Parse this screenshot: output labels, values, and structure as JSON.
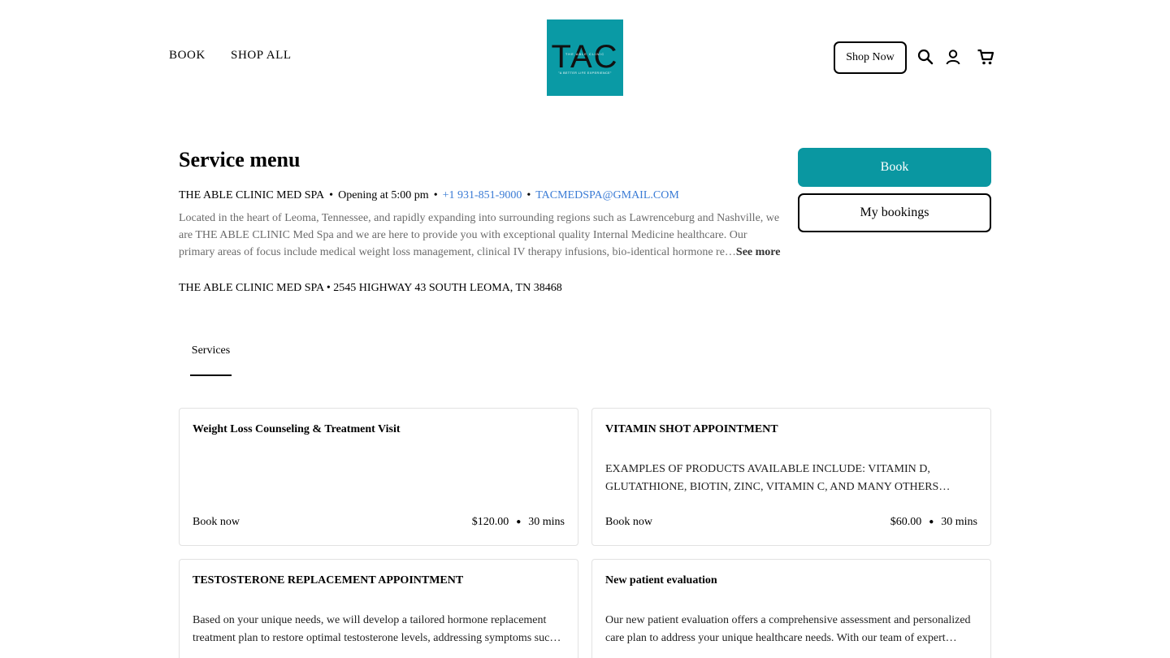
{
  "header": {
    "nav": [
      "BOOK",
      "SHOP ALL"
    ],
    "logo": {
      "text": "TAC",
      "arc_text": "THE ABLE CLINIC",
      "tagline": "\"A BETTER LIFE EXPERIENCE\""
    },
    "shop_now_label": "Shop Now",
    "icons": [
      "search-icon",
      "account-icon",
      "cart-icon"
    ]
  },
  "page": {
    "title": "Service menu",
    "business_name": "THE ABLE CLINIC MED SPA",
    "hours": "Opening at 5:00 pm",
    "phone": "+1 931-851-9000",
    "email": "TACMEDSPA@GMAIL.COM",
    "description": "Located in the heart of Leoma, Tennessee, and rapidly expanding into surrounding regions such as Lawrenceburg and Nashville, we are THE ABLE CLINIC Med Spa and we are here to provide you with exceptional quality Internal Medicine healthcare. Our primary areas of focus include medical weight loss management, clinical IV therapy infusions, bio-identical hormone re…",
    "see_more_label": "See more",
    "address": "THE ABLE CLINIC MED SPA • 2545 HIGHWAY 43 SOUTH LEOMA, TN 38468",
    "book_label": "Book",
    "my_bookings_label": "My bookings"
  },
  "tabs": [
    "Services"
  ],
  "services": [
    {
      "title": "Weight Loss Counseling & Treatment Visit",
      "description": "",
      "book_label": "Book now",
      "price": "$120.00",
      "duration": "30 mins"
    },
    {
      "title": "VITAMIN SHOT APPOINTMENT",
      "description": "EXAMPLES OF PRODUCTS AVAILABLE INCLUDE: VITAMIN D, GLUTATHIONE, BIOTIN, ZINC, VITAMIN C, AND MANY OTHERS…",
      "book_label": "Book now",
      "price": "$60.00",
      "duration": "30 mins"
    },
    {
      "title": "TESTOSTERONE REPLACEMENT APPOINTMENT",
      "description": "Based on your unique needs, we will develop a tailored hormone replacement treatment plan to restore optimal testosterone levels, addressing symptoms suc…",
      "book_label": "Book now",
      "price": "",
      "duration": ""
    },
    {
      "title": "New patient evaluation",
      "description": "Our new patient evaluation offers a comprehensive assessment and personalized care plan to address your unique healthcare needs. With our team of expert…",
      "book_label": "Book now",
      "price": "",
      "duration": ""
    }
  ],
  "colors": {
    "accent": "#0a97a1",
    "link": "#3a7bd5",
    "muted_text": "#6b6b6b"
  }
}
